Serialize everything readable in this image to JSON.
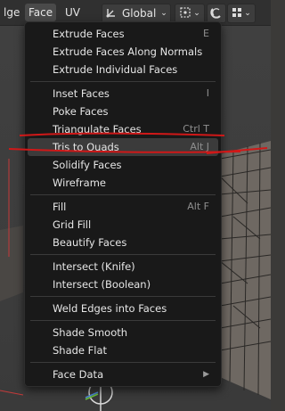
{
  "header": {
    "edge_menu_label": "lge",
    "face_menu_label": "Face",
    "uv_menu_label": "UV",
    "transform_orientation": "Global",
    "transform_orientation_icon": "axes-icon",
    "pivot_icon": "pivot-point-icon",
    "snap_icon": "magnet-snap-icon",
    "snap_grid_icon": "grid-snap-icon"
  },
  "menu": {
    "items": [
      {
        "label": "Extrude Faces",
        "shortcut": "E"
      },
      {
        "label": "Extrude Faces Along Normals",
        "shortcut": ""
      },
      {
        "label": "Extrude Individual Faces",
        "shortcut": ""
      },
      {
        "label": "Inset Faces",
        "shortcut": "I"
      },
      {
        "label": "Poke Faces",
        "shortcut": ""
      },
      {
        "label": "Triangulate Faces",
        "shortcut": "Ctrl T"
      },
      {
        "label": "Tris to Quads",
        "shortcut": "Alt J"
      },
      {
        "label": "Solidify Faces",
        "shortcut": ""
      },
      {
        "label": "Wireframe",
        "shortcut": ""
      },
      {
        "label": "Fill",
        "shortcut": "Alt F"
      },
      {
        "label": "Grid Fill",
        "shortcut": ""
      },
      {
        "label": "Beautify Faces",
        "shortcut": ""
      },
      {
        "label": "Intersect (Knife)",
        "shortcut": ""
      },
      {
        "label": "Intersect (Boolean)",
        "shortcut": ""
      },
      {
        "label": "Weld Edges into Faces",
        "shortcut": ""
      },
      {
        "label": "Shade Smooth",
        "shortcut": ""
      },
      {
        "label": "Shade Flat",
        "shortcut": ""
      },
      {
        "label": "Face Data",
        "shortcut": ""
      }
    ],
    "highlighted_item": "Tris to Quads",
    "submenu_icon": "chevron-right-icon"
  },
  "colors": {
    "menu_bg": "#191919",
    "highlight_bg": "#3b3b3b",
    "annotation_red": "#d01818"
  }
}
